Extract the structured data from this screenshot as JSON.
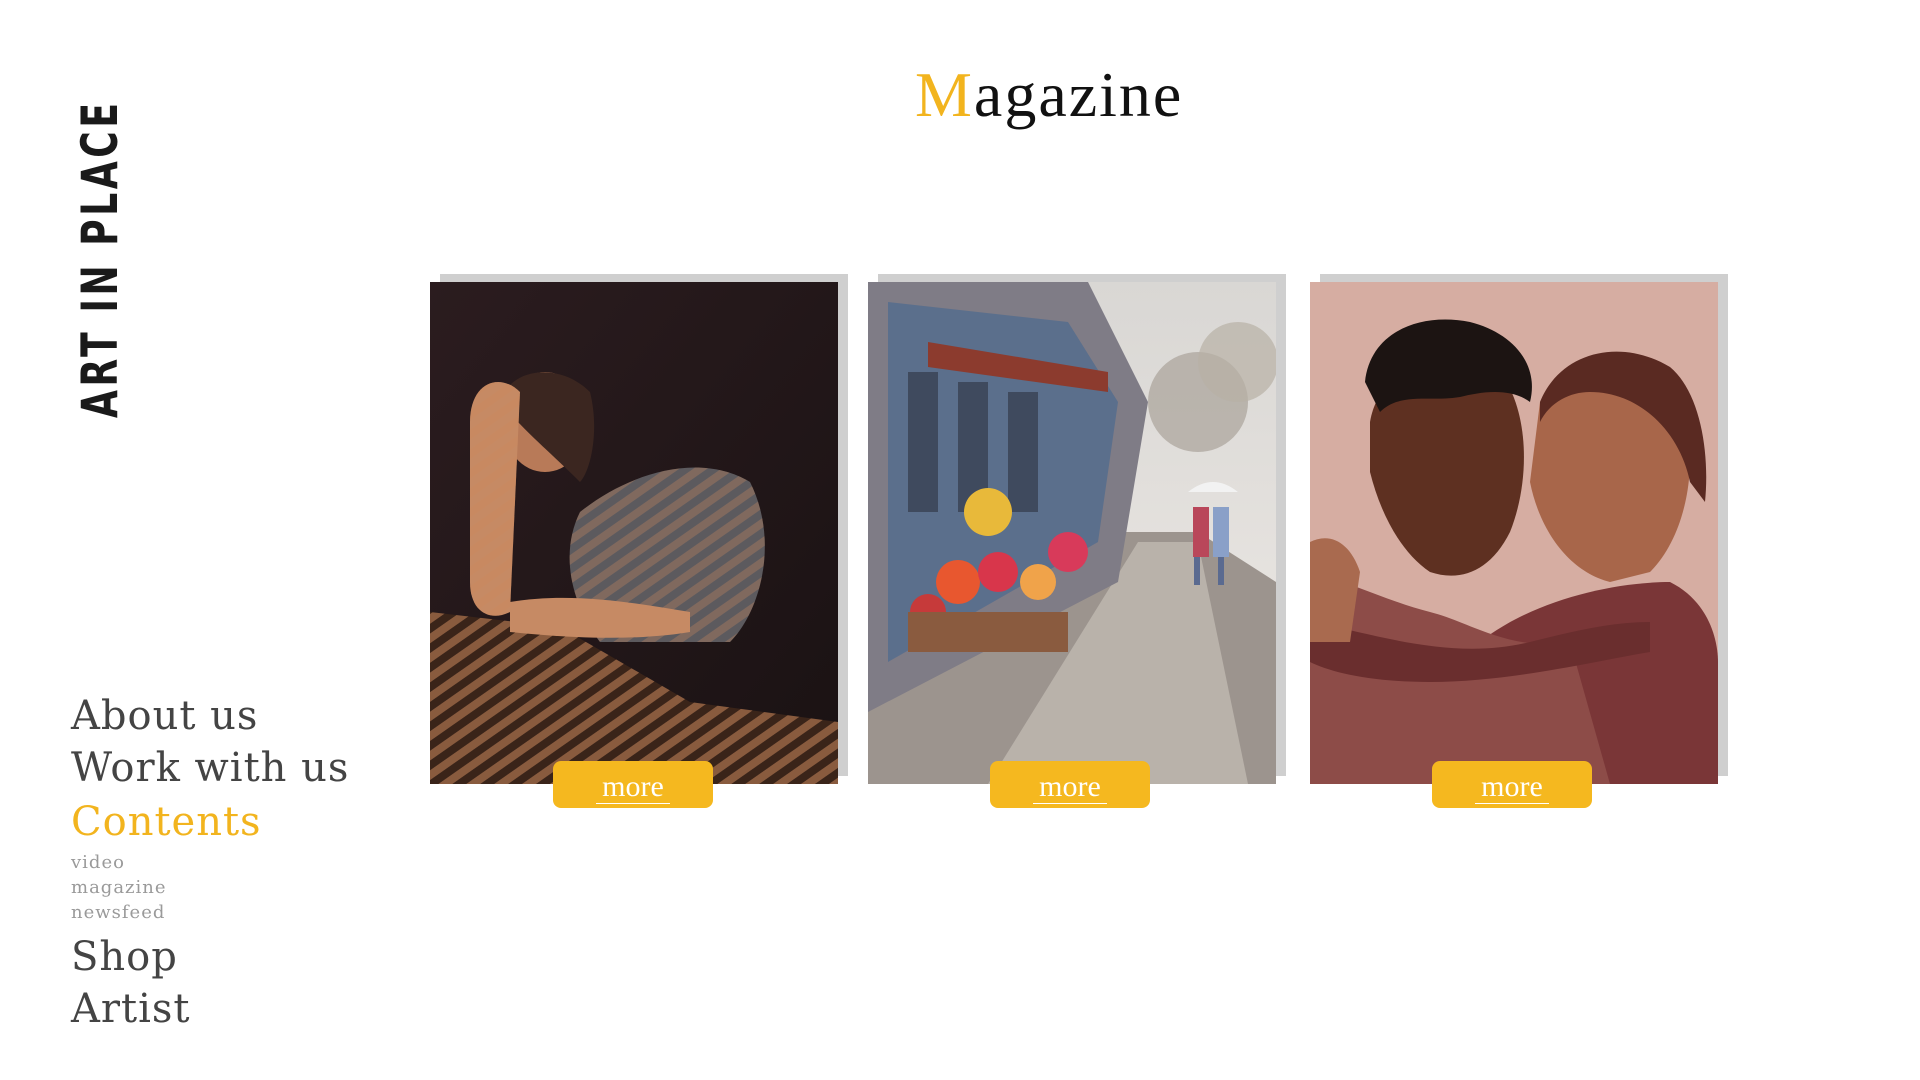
{
  "brand": {
    "name": "ART IN PLACE"
  },
  "header": {
    "title_initial": "M",
    "title_rest": "agazine"
  },
  "nav": {
    "about": "About us",
    "work": "Work with us",
    "contents": "Contents",
    "sub": [
      "video",
      "magazine",
      "newsfeed"
    ],
    "shop": "Shop",
    "artist": "Artist"
  },
  "cards": [
    {
      "more_label": "more"
    },
    {
      "more_label": "more"
    },
    {
      "more_label": "more"
    }
  ],
  "colors": {
    "accent": "#f2b41e",
    "button": "#f5b81f",
    "text": "#444444",
    "subtext": "#9a9a9a"
  }
}
